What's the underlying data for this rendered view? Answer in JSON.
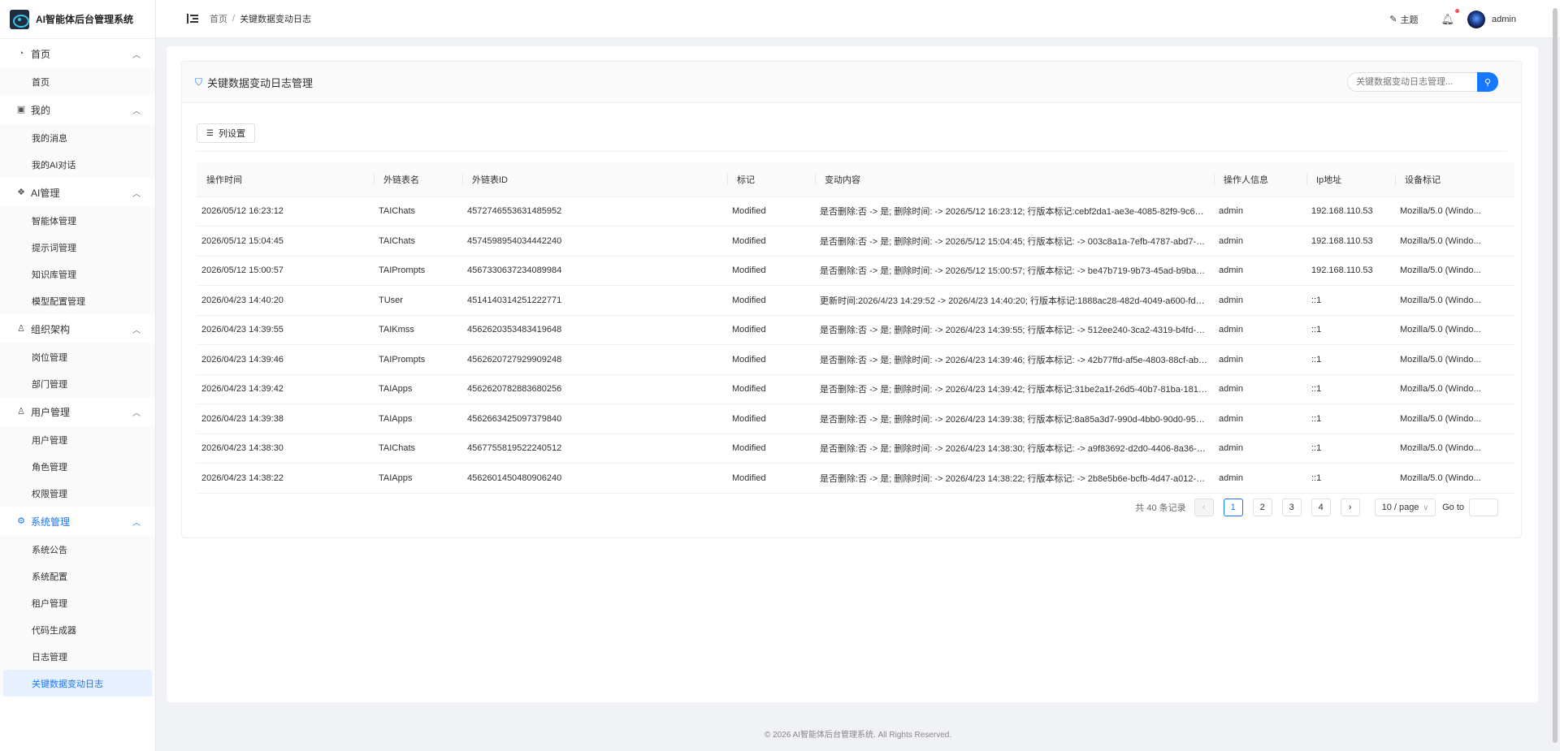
{
  "app": {
    "title": "AI智能体后台管理系统"
  },
  "sidebar": {
    "groups": [
      {
        "label": "首页",
        "icon": "dashboard-icon",
        "items": [
          "首页"
        ]
      },
      {
        "label": "我的",
        "icon": "profile-icon",
        "items": [
          "我的消息",
          "我的AI对话"
        ]
      },
      {
        "label": "AI管理",
        "icon": "ai-icon",
        "items": [
          "智能体管理",
          "提示词管理",
          "知识库管理",
          "模型配置管理"
        ]
      },
      {
        "label": "组织架构",
        "icon": "user-icon",
        "items": [
          "岗位管理",
          "部门管理"
        ]
      },
      {
        "label": "用户管理",
        "icon": "user-icon",
        "items": [
          "用户管理",
          "角色管理",
          "权限管理"
        ]
      },
      {
        "label": "系统管理",
        "icon": "gear-icon",
        "items": [
          "系统公告",
          "系统配置",
          "租户管理",
          "代码生成器",
          "日志管理",
          "关键数据变动日志"
        ]
      }
    ],
    "active_group": "系统管理",
    "active_item": "关键数据变动日志"
  },
  "header": {
    "breadcrumb": [
      "首页",
      "关键数据变动日志"
    ],
    "theme_label": "主题",
    "username": "admin"
  },
  "panel": {
    "title": "关键数据变动日志管理",
    "search_placeholder": "关键数据变动日志管理...",
    "column_settings_label": "列设置"
  },
  "table": {
    "columns": [
      "操作时间",
      "外链表名",
      "外链表ID",
      "标记",
      "变动内容",
      "操作人信息",
      "Ip地址",
      "设备标记"
    ],
    "rows": [
      [
        "2026/05/12 16:23:12",
        "TAIChats",
        "4572746553631485952",
        "Modified",
        "是否删除:否 -> 是;  删除时间: -> 2026/5/12 16:23:12;  行版本标记:cebf2da1-ae3e-4085-82f9-9c6290c...",
        "admin",
        "192.168.110.53",
        "Mozilla/5.0 (Windo..."
      ],
      [
        "2026/05/12 15:04:45",
        "TAIChats",
        "4574598954034442240",
        "Modified",
        "是否删除:否 -> 是;  删除时间: -> 2026/5/12 15:04:45;  行版本标记: -> 003c8a1a-7efb-4787-abd7-cec5...",
        "admin",
        "192.168.110.53",
        "Mozilla/5.0 (Windo..."
      ],
      [
        "2026/05/12 15:00:57",
        "TAIPrompts",
        "4567330637234089984",
        "Modified",
        "是否删除:否 -> 是;  删除时间: -> 2026/5/12 15:00:57;  行版本标记: -> be47b719-9b73-45ad-b9ba-bce...",
        "admin",
        "192.168.110.53",
        "Mozilla/5.0 (Windo..."
      ],
      [
        "2026/04/23 14:40:20",
        "TUser",
        "4514140314251222771",
        "Modified",
        "更新时间:2026/4/23 14:29:52 -> 2026/4/23 14:40:20;  行版本标记:1888ac28-482d-4049-a600-fd9c1ec7...",
        "admin",
        "::1",
        "Mozilla/5.0 (Windo..."
      ],
      [
        "2026/04/23 14:39:55",
        "TAIKmss",
        "4562620353483419648",
        "Modified",
        "是否删除:否 -> 是;  删除时间: -> 2026/4/23 14:39:55;  行版本标记: -> 512ee240-3ca2-4319-b4fd-7d4...",
        "admin",
        "::1",
        "Mozilla/5.0 (Windo..."
      ],
      [
        "2026/04/23 14:39:46",
        "TAIPrompts",
        "4562620727929909248",
        "Modified",
        "是否删除:否 -> 是;  删除时间: -> 2026/4/23 14:39:46;  行版本标记: -> 42b77ffd-af5e-4803-88cf-ab007...",
        "admin",
        "::1",
        "Mozilla/5.0 (Windo..."
      ],
      [
        "2026/04/23 14:39:42",
        "TAIApps",
        "4562620782883680256",
        "Modified",
        "是否删除:否 -> 是;  删除时间: -> 2026/4/23 14:39:42;  行版本标记:31be2a1f-26d5-40b7-81ba-181f856...",
        "admin",
        "::1",
        "Mozilla/5.0 (Windo..."
      ],
      [
        "2026/04/23 14:39:38",
        "TAIApps",
        "4562663425097379840",
        "Modified",
        "是否删除:否 -> 是;  删除时间: -> 2026/4/23 14:39:38;  行版本标记:8a85a3d7-990d-4bb0-90d0-95135e...",
        "admin",
        "::1",
        "Mozilla/5.0 (Windo..."
      ],
      [
        "2026/04/23 14:38:30",
        "TAIChats",
        "4567755819522240512",
        "Modified",
        "是否删除:否 -> 是;  删除时间: -> 2026/4/23 14:38:30;  行版本标记: -> a9f83692-d2d0-4406-8a36-921...",
        "admin",
        "::1",
        "Mozilla/5.0 (Windo..."
      ],
      [
        "2026/04/23 14:38:22",
        "TAIApps",
        "4562601450480906240",
        "Modified",
        "是否删除:否 -> 是;  删除时间: -> 2026/4/23 14:38:22;  行版本标记: -> 2b8e5b6e-bcfb-4d47-a012-4e5...",
        "admin",
        "::1",
        "Mozilla/5.0 (Windo..."
      ]
    ]
  },
  "pagination": {
    "total_label": "共 40 条记录",
    "pages": [
      "1",
      "2",
      "3",
      "4"
    ],
    "current": "1",
    "page_size": "10 / page",
    "goto_label": "Go to"
  },
  "footer": {
    "text": "© 2026 AI智能体后台管理系统. All Rights Reserved."
  },
  "colors": {
    "accent": "#1677ff",
    "badge": "#ff4d4f"
  }
}
